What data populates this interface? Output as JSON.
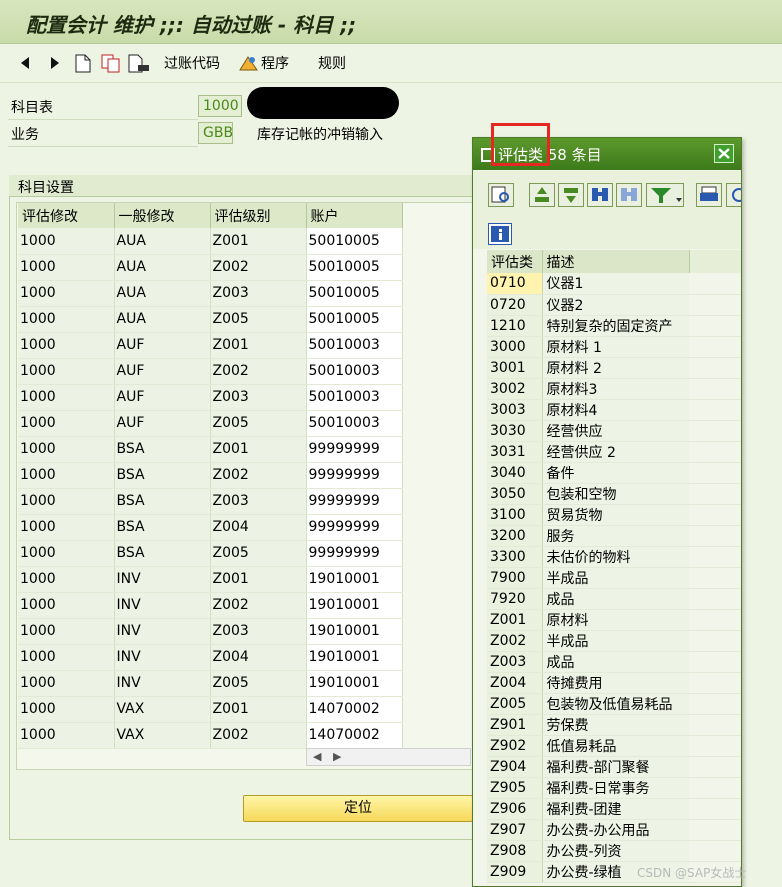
{
  "window": {
    "title": "配置会计 维护 ;;: 自动过账 - 科目 ;;"
  },
  "toolbar": {
    "post_code_label": "过账代码",
    "program_label": "程序",
    "rules_label": "规则"
  },
  "fields": {
    "chart_of_accounts_label": "科目表",
    "chart_of_accounts_value": "1000",
    "transaction_label": "业务",
    "transaction_value": "GBB",
    "transaction_desc": "库存记帐的冲销输入"
  },
  "group": {
    "title": "科目设置"
  },
  "table": {
    "columns": [
      "评估修改",
      "一般修改",
      "评估级别",
      "账户"
    ],
    "rows": [
      [
        "1000",
        "AUA",
        "Z001",
        "50010005"
      ],
      [
        "1000",
        "AUA",
        "Z002",
        "50010005"
      ],
      [
        "1000",
        "AUA",
        "Z003",
        "50010005"
      ],
      [
        "1000",
        "AUA",
        "Z005",
        "50010005"
      ],
      [
        "1000",
        "AUF",
        "Z001",
        "50010003"
      ],
      [
        "1000",
        "AUF",
        "Z002",
        "50010003"
      ],
      [
        "1000",
        "AUF",
        "Z003",
        "50010003"
      ],
      [
        "1000",
        "AUF",
        "Z005",
        "50010003"
      ],
      [
        "1000",
        "BSA",
        "Z001",
        "99999999"
      ],
      [
        "1000",
        "BSA",
        "Z002",
        "99999999"
      ],
      [
        "1000",
        "BSA",
        "Z003",
        "99999999"
      ],
      [
        "1000",
        "BSA",
        "Z004",
        "99999999"
      ],
      [
        "1000",
        "BSA",
        "Z005",
        "99999999"
      ],
      [
        "1000",
        "INV",
        "Z001",
        "19010001"
      ],
      [
        "1000",
        "INV",
        "Z002",
        "19010001"
      ],
      [
        "1000",
        "INV",
        "Z003",
        "19010001"
      ],
      [
        "1000",
        "INV",
        "Z004",
        "19010001"
      ],
      [
        "1000",
        "INV",
        "Z005",
        "19010001"
      ],
      [
        "1000",
        "VAX",
        "Z001",
        "14070002"
      ],
      [
        "1000",
        "VAX",
        "Z002",
        "14070002"
      ]
    ]
  },
  "locate_button": {
    "label": "定位"
  },
  "popup": {
    "title": "评估类 58 条目",
    "columns": [
      "评估类",
      "描述"
    ],
    "rows": [
      [
        "0710",
        "仪器1"
      ],
      [
        "0720",
        "仪器2"
      ],
      [
        "1210",
        "特别复杂的固定资产"
      ],
      [
        "3000",
        "原材料 1"
      ],
      [
        "3001",
        "原材料 2"
      ],
      [
        "3002",
        "原材料3"
      ],
      [
        "3003",
        "原材料4"
      ],
      [
        "3030",
        "经营供应"
      ],
      [
        "3031",
        "经营供应 2"
      ],
      [
        "3040",
        "备件"
      ],
      [
        "3050",
        "包装和空物"
      ],
      [
        "3100",
        "贸易货物"
      ],
      [
        "3200",
        "服务"
      ],
      [
        "3300",
        "未估价的物料"
      ],
      [
        "7900",
        "半成品"
      ],
      [
        "7920",
        "成品"
      ],
      [
        "Z001",
        "原材料"
      ],
      [
        "Z002",
        "半成品"
      ],
      [
        "Z003",
        "成品"
      ],
      [
        "Z004",
        "待摊费用"
      ],
      [
        "Z005",
        "包装物及低值易耗品"
      ],
      [
        "Z901",
        "劳保费"
      ],
      [
        "Z902",
        "低值易耗品"
      ],
      [
        "Z904",
        "福利费-部门聚餐"
      ],
      [
        "Z905",
        "福利费-日常事务"
      ],
      [
        "Z906",
        "福利费-团建"
      ],
      [
        "Z907",
        "办公费-办公用品"
      ],
      [
        "Z908",
        "办公费-列资"
      ],
      [
        "Z909",
        "办公费-绿植"
      ]
    ]
  },
  "watermark": "CSDN @SAP女战士",
  "colors": {
    "titlebar_bg": "#cfe0b1",
    "popup_title_bg": "#4a8a22",
    "accent_value": "#4a8a1a",
    "highlight_red": "#e52822",
    "locate_button_bg": "#f8df6a"
  }
}
